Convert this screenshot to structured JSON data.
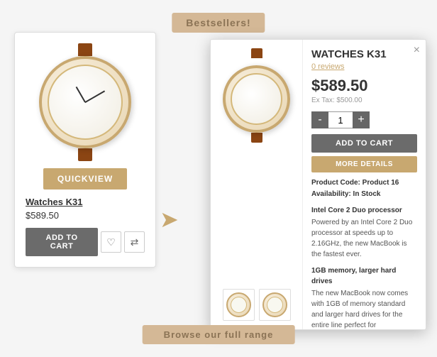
{
  "page": {
    "bg_text_top": "Bestsellers!",
    "bg_text_bottom": "Browse our full range"
  },
  "product_card": {
    "name": "Watches K31",
    "price": "$589.50",
    "quickview_label": "QUICKVIEW",
    "add_to_cart_label": "ADD TO CART",
    "wishlist_icon": "♡",
    "compare_icon": "⇄"
  },
  "modal": {
    "close_icon": "×",
    "title": "WATCHES K31",
    "reviews_label": "0 reviews",
    "price": "$589.50",
    "tax_label": "Ex Tax: $500.00",
    "qty_value": "1",
    "qty_minus": "-",
    "qty_plus": "+",
    "add_to_cart_label": "ADD TO CART",
    "more_details_label": "MORE DETAILS",
    "product_code_label": "Product Code:",
    "product_code_value": "Product 16",
    "availability_label": "Availability:",
    "availability_value": "In Stock",
    "desc_sections": [
      {
        "title": "Intel Core 2 Duo processor",
        "body": "Powered by an Intel Core 2 Duo processor at speeds up to 2.16GHz, the new MacBook is the fastest ever."
      },
      {
        "title": "1GB memory, larger hard drives",
        "body": "The new MacBook now comes with 1GB of memory standard and larger hard drives for the entire line perfect for"
      }
    ]
  }
}
